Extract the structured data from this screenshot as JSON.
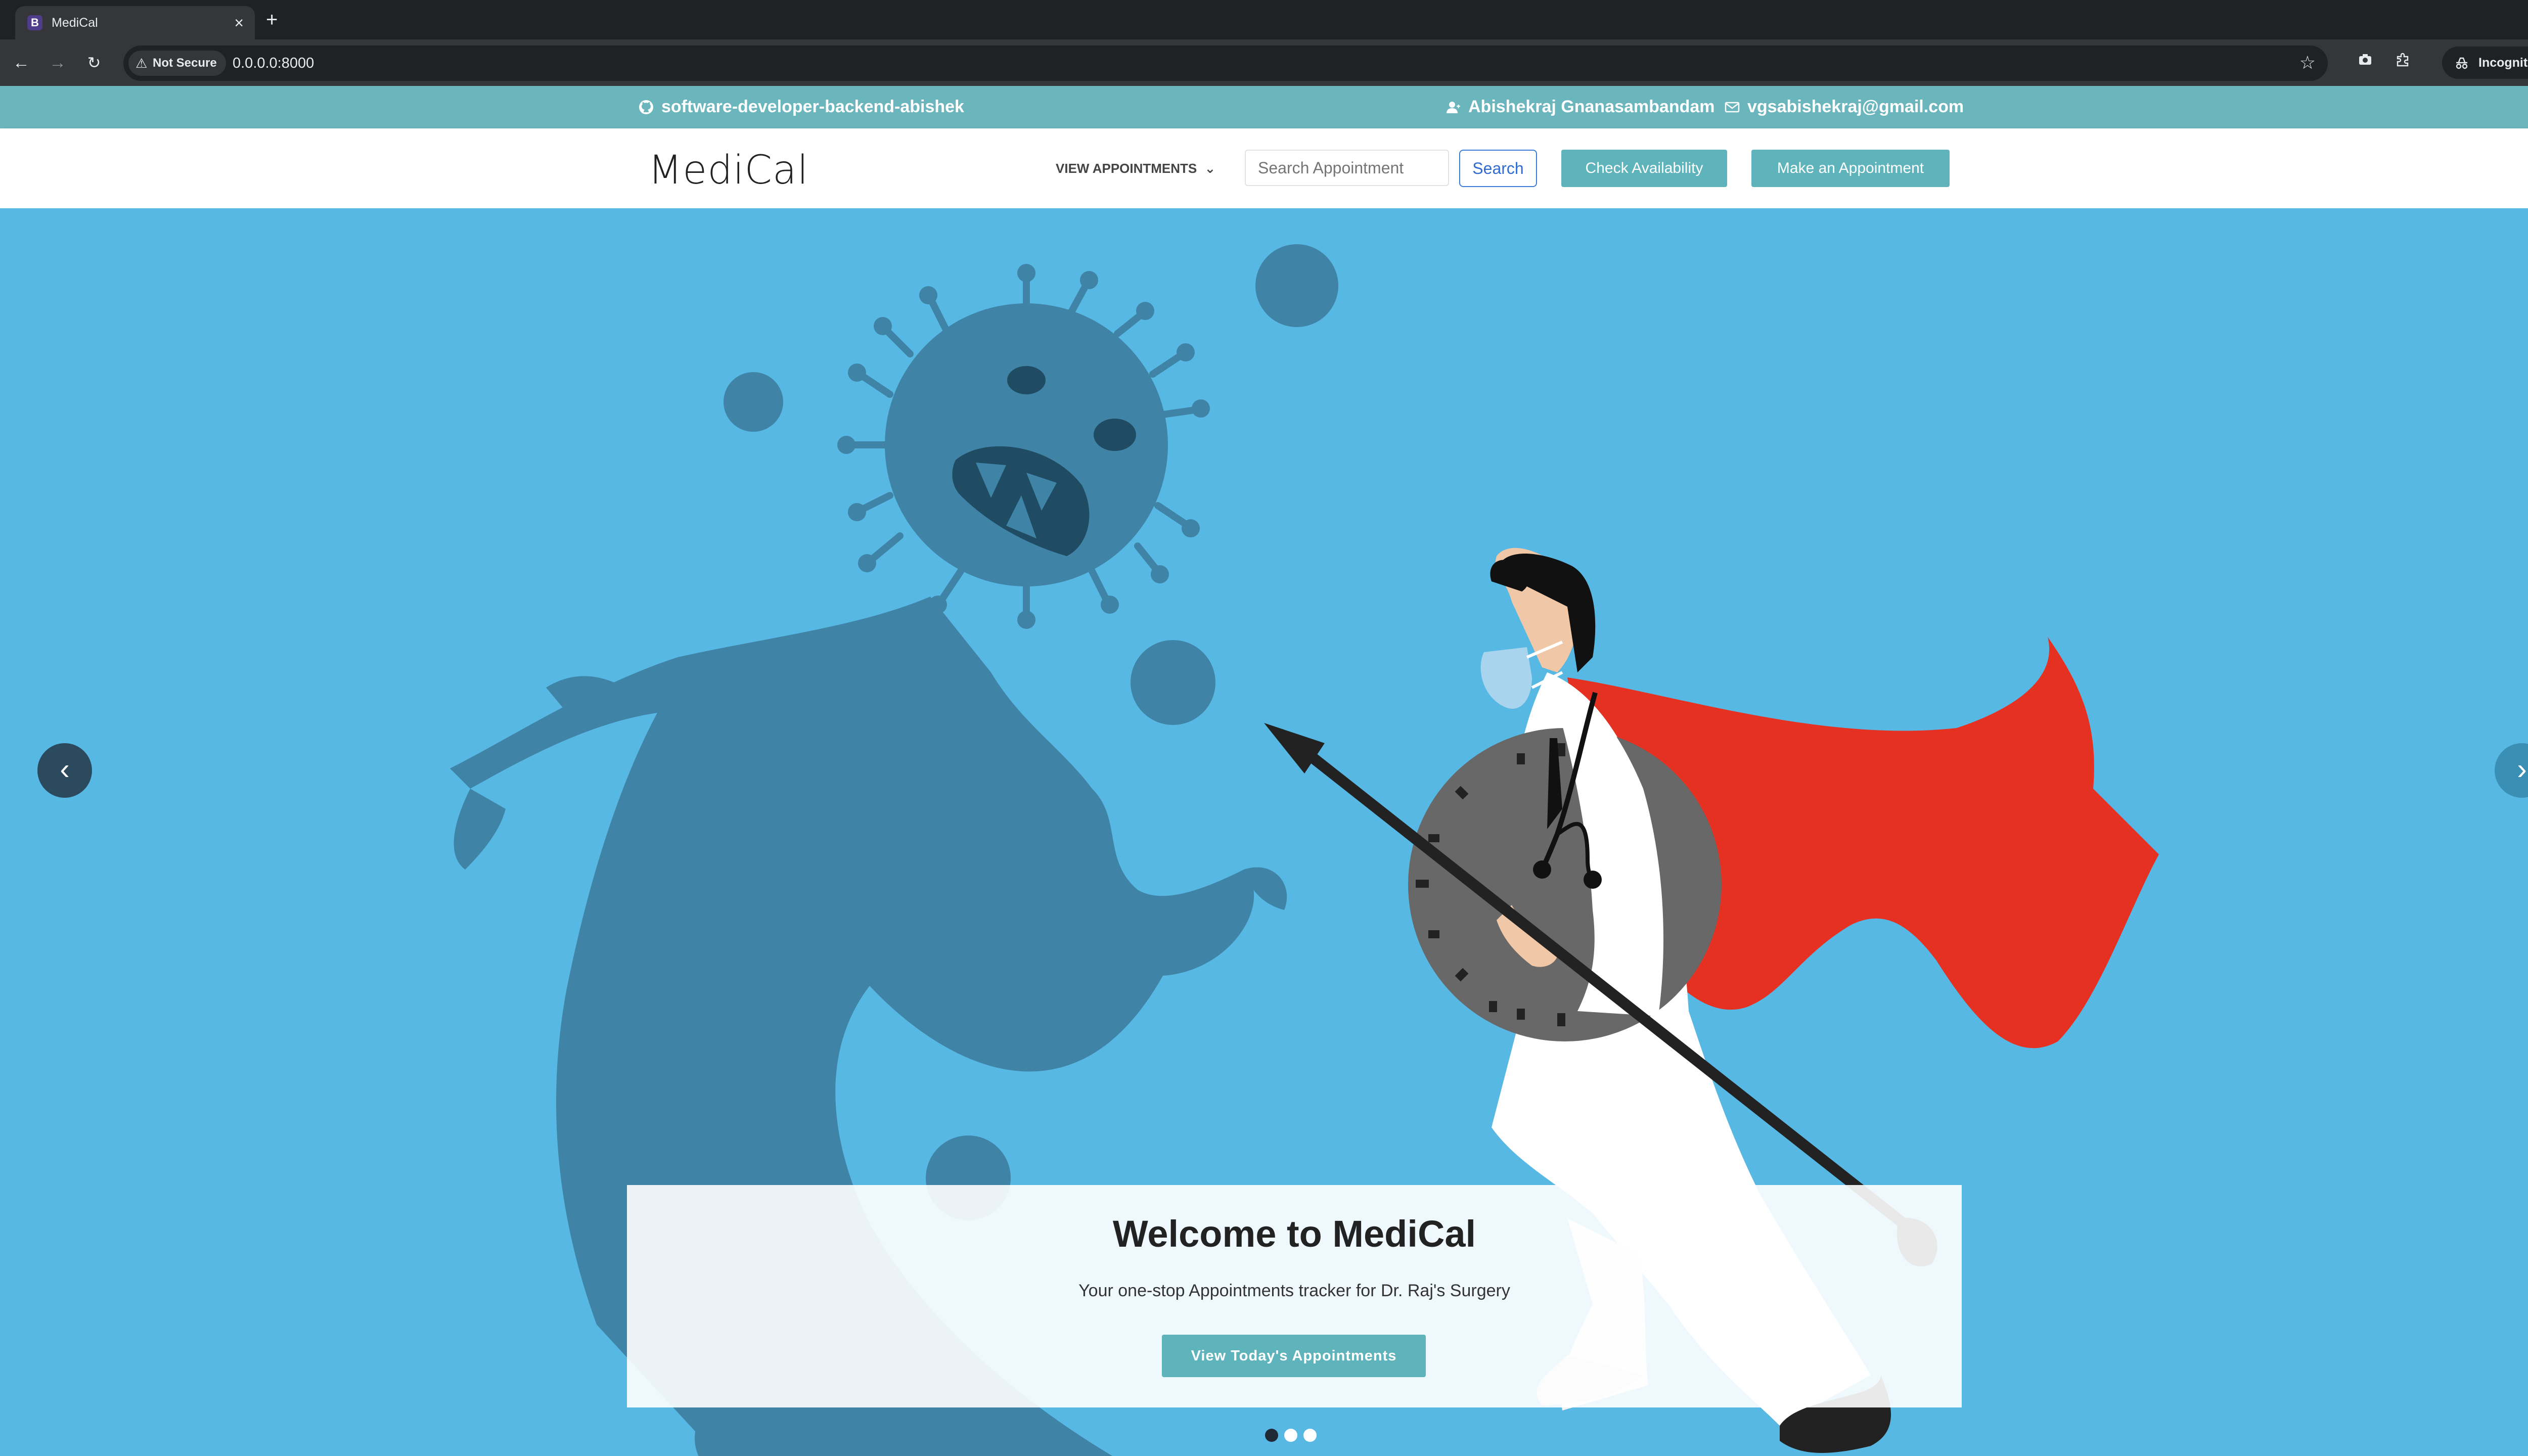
{
  "browser": {
    "tab_title": "MediCal",
    "tab_favicon_letter": "B",
    "new_tab": "+",
    "security_label": "Not Secure",
    "url": "0.0.0.0:8000",
    "incognito_label": "Incognito"
  },
  "topbar": {
    "github_label": "software-developer-backend-abishek",
    "user_name": "Abishekraj Gnanasambandam",
    "email": "vgsabishekraj@gmail.com"
  },
  "navbar": {
    "brand": "MediCal",
    "view_appointments": "VIEW APPOINTMENTS",
    "search_placeholder": "Search Appointment",
    "search_button": "Search",
    "check_availability": "Check Availability",
    "make_appointment": "Make an Appointment"
  },
  "hero": {
    "title": "Welcome to MediCal",
    "subtitle": "Your one-stop Appointments tracker for Dr. Raj's Surgery",
    "cta": "View Today's Appointments",
    "slide_count": 3,
    "active_slide": 1
  },
  "colors": {
    "accent": "#5fb3ba",
    "hero_bg": "#58b8e4",
    "virus": "#3f83a6",
    "cape": "#e53122"
  }
}
